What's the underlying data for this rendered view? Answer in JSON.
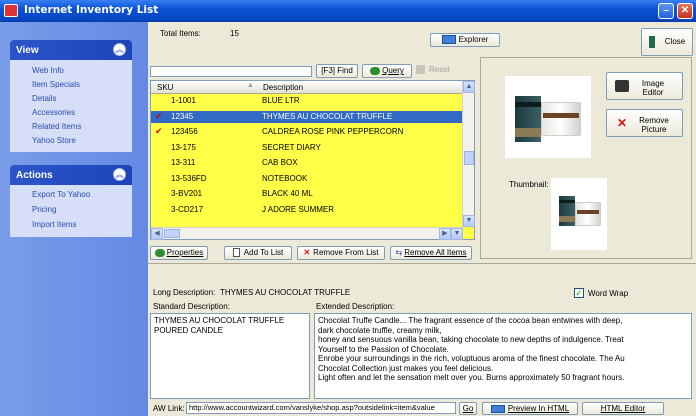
{
  "window": {
    "title": "Internet Inventory List"
  },
  "sidebar": {
    "view": {
      "title": "View",
      "items": [
        "Web Info",
        "Item Specials",
        "Details",
        "Accessories",
        "Related Items",
        "Yahoo Store"
      ]
    },
    "actions": {
      "title": "Actions",
      "items": [
        "Export To Yahoo",
        "Pricing",
        "Import Items"
      ]
    }
  },
  "header": {
    "total_label": "Total Items:",
    "total_value": "15",
    "explorer_label": "Explorer",
    "close_label": "Close"
  },
  "search": {
    "value": "",
    "find_label": "[F3] Find",
    "query_label": "Query",
    "reset_label": "Reset"
  },
  "grid": {
    "columns": [
      "SKU",
      "Description"
    ],
    "rows": [
      {
        "sku": "1-1001",
        "desc": "BLUE LTR",
        "checked": false,
        "selected": false
      },
      {
        "sku": "12345",
        "desc": "THYMES AU CHOCOLAT TRUFFLE",
        "checked": true,
        "selected": true
      },
      {
        "sku": "123456",
        "desc": "CALDREA ROSE PINK PEPPERCORN",
        "checked": true,
        "selected": false
      },
      {
        "sku": "13-175",
        "desc": "SECRET DIARY",
        "checked": false,
        "selected": false
      },
      {
        "sku": "13-311",
        "desc": "CAB BOX",
        "checked": false,
        "selected": false
      },
      {
        "sku": "13-536FD",
        "desc": "NOTEBOOK",
        "checked": false,
        "selected": false
      },
      {
        "sku": "3-BV201",
        "desc": "BLACK 40 ML",
        "checked": false,
        "selected": false
      },
      {
        "sku": "3-CD217",
        "desc": "J ADORE SUMMER",
        "checked": false,
        "selected": false
      }
    ]
  },
  "list_buttons": {
    "properties": "Properties",
    "add": "Add To List",
    "remove": "Remove From List",
    "remove_all": "Remove All Items"
  },
  "image_panel": {
    "editor_label": "Image Editor",
    "remove_label": "Remove Picture",
    "thumbnail_label": "Thumbnail:"
  },
  "details": {
    "long_label": "Long Description:",
    "long_value": "THYMES AU CHOCOLAT TRUFFLE",
    "word_wrap_label": "Word Wrap",
    "standard_label": "Standard Description:",
    "standard_value": "THYMES AU CHOCOLAT TRUFFLE POURED CANDLE",
    "extended_label": "Extended Description:",
    "extended_lines": [
      "Chocolat Truffe Candle... The fragrant essence of the cocoa bean entwines with deep,",
      "dark chocolate truffle, creamy milk,",
      "honey and sensuous vanilla bean, taking chocolate to new depths of indulgence. Treat",
      "Yourself to the Passion of Chocolate.",
      "Enrobe your surroundings in the rich, voluptuous aroma of the finest chocolate. The Au",
      "Chocolat Collection just makes you feel delicious.",
      "Light often and let the sensation melt over you. Burns approximately 50 fragrant hours."
    ],
    "aw_link_label": "AW Link:",
    "aw_link_value": "http://www.accountwizard.com/vanslyke/shop.asp?outsidelink=item&value",
    "go_label": "Go",
    "preview_label": "Preview In HTML",
    "html_editor_label": "HTML Editor"
  },
  "colors": {
    "grid_bg": "#ffff48",
    "selection": "#316ac5",
    "title_bar": "#0a52d6"
  }
}
